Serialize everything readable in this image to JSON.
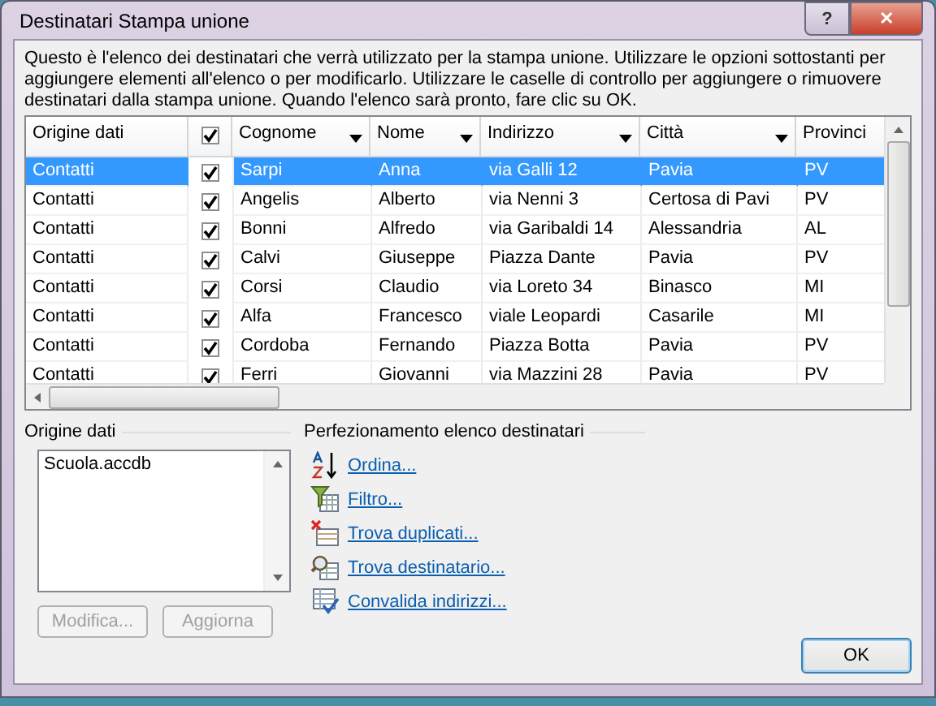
{
  "window": {
    "title": "Destinatari Stampa unione",
    "buttons": [
      {
        "kind": "help",
        "label": "?"
      },
      {
        "kind": "close",
        "label": "✕"
      }
    ]
  },
  "intro": "Questo è l'elenco dei destinatari che verrà utilizzato per la stampa unione. Utilizzare le opzioni sottostanti per aggiungere elementi all'elenco o per modificarlo. Utilizzare le caselle di controllo per aggiungere o rimuovere destinatari dalla stampa unione. Quando l'elenco sarà pronto, fare clic su OK.",
  "table": {
    "select_all": {
      "checked": true
    },
    "columns": [
      {
        "label": "Origine dati",
        "dropdown": false
      },
      {
        "label": "Cognome",
        "dropdown": true
      },
      {
        "label": "Nome",
        "dropdown": true
      },
      {
        "label": "Indirizzo",
        "dropdown": true
      },
      {
        "label": "Città",
        "dropdown": true
      },
      {
        "label": "Provinci",
        "dropdown": false
      }
    ],
    "rows": [
      {
        "selected": true,
        "checked": true,
        "cells": [
          "Contatti",
          "Sarpi",
          "Anna",
          "via Galli 12",
          "Pavia",
          "PV"
        ]
      },
      {
        "selected": false,
        "checked": true,
        "cells": [
          "Contatti",
          "Angelis",
          "Alberto",
          "via Nenni 3",
          "Certosa di Pavi",
          "PV"
        ]
      },
      {
        "selected": false,
        "checked": true,
        "cells": [
          "Contatti",
          "Bonni",
          "Alfredo",
          "via Garibaldi 14",
          "Alessandria",
          "AL"
        ]
      },
      {
        "selected": false,
        "checked": true,
        "cells": [
          "Contatti",
          "Calvi",
          "Giuseppe",
          "Piazza Dante",
          "Pavia",
          "PV"
        ]
      },
      {
        "selected": false,
        "checked": true,
        "cells": [
          "Contatti",
          "Corsi",
          "Claudio",
          "via Loreto 34",
          "Binasco",
          "MI"
        ]
      },
      {
        "selected": false,
        "checked": true,
        "cells": [
          "Contatti",
          "Alfa",
          "Francesco",
          "viale Leopardi",
          "Casarile",
          "MI"
        ]
      },
      {
        "selected": false,
        "checked": true,
        "cells": [
          "Contatti",
          "Cordoba",
          "Fernando",
          "Piazza Botta",
          "Pavia",
          "PV"
        ]
      },
      {
        "selected": false,
        "checked": true,
        "cells": [
          "Contatti",
          "Ferri",
          "Giovanni",
          "via Mazzini 28",
          "Pavia",
          "PV"
        ]
      }
    ]
  },
  "sources": {
    "title": "Origine dati",
    "items": [
      "Scuola.accdb"
    ],
    "buttons": [
      {
        "label": "Modifica...",
        "disabled": true
      },
      {
        "label": "Aggiorna",
        "disabled": true
      }
    ]
  },
  "refine": {
    "title": "Perfezionamento elenco destinatari",
    "links": [
      {
        "kind": "sort",
        "label": "Ordina..."
      },
      {
        "kind": "filter",
        "label": "Filtro..."
      },
      {
        "kind": "duplicates",
        "label": "Trova duplicati..."
      },
      {
        "kind": "find",
        "label": "Trova destinatario..."
      },
      {
        "kind": "validate",
        "label": "Convalida indirizzi..."
      }
    ]
  },
  "ok_button": "OK"
}
